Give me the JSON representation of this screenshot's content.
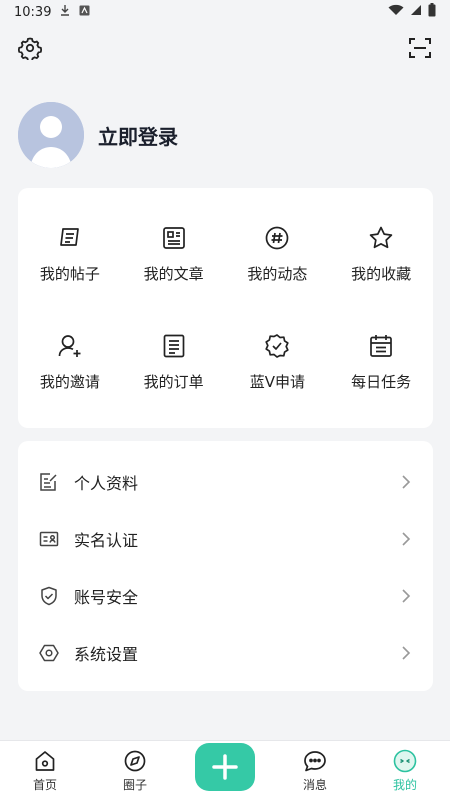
{
  "status_bar": {
    "time": "10:39"
  },
  "profile": {
    "login_label": "立即登录"
  },
  "grid": [
    {
      "label": "我的帖子"
    },
    {
      "label": "我的文章"
    },
    {
      "label": "我的动态"
    },
    {
      "label": "我的收藏"
    },
    {
      "label": "我的邀请"
    },
    {
      "label": "我的订单"
    },
    {
      "label": "蓝V申请"
    },
    {
      "label": "每日任务"
    }
  ],
  "menu": [
    {
      "label": "个人资料"
    },
    {
      "label": "实名认证"
    },
    {
      "label": "账号安全"
    },
    {
      "label": "系统设置"
    }
  ],
  "tabbar": [
    {
      "label": "首页"
    },
    {
      "label": "圈子"
    },
    {
      "label": "消息"
    },
    {
      "label": "我的"
    }
  ],
  "colors": {
    "accent": "#35c9a6",
    "active_tab": "#2cc2a0",
    "text": "#1f2329"
  }
}
